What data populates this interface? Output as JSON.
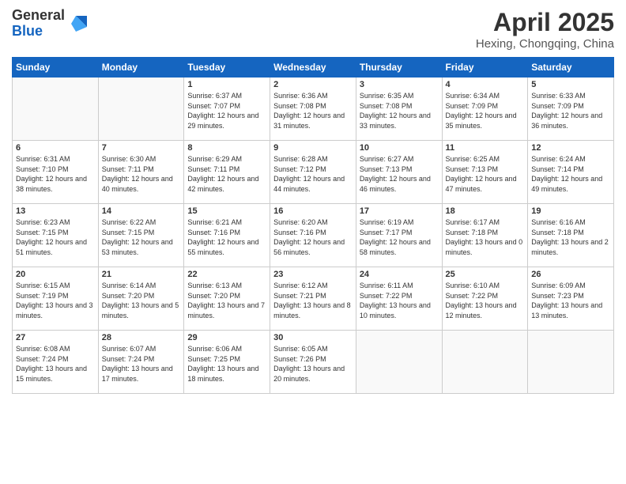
{
  "logo": {
    "general": "General",
    "blue": "Blue"
  },
  "title": "April 2025",
  "location": "Hexing, Chongqing, China",
  "days_header": [
    "Sunday",
    "Monday",
    "Tuesday",
    "Wednesday",
    "Thursday",
    "Friday",
    "Saturday"
  ],
  "weeks": [
    [
      {
        "num": "",
        "sunrise": "",
        "sunset": "",
        "daylight": ""
      },
      {
        "num": "",
        "sunrise": "",
        "sunset": "",
        "daylight": ""
      },
      {
        "num": "1",
        "sunrise": "Sunrise: 6:37 AM",
        "sunset": "Sunset: 7:07 PM",
        "daylight": "Daylight: 12 hours and 29 minutes."
      },
      {
        "num": "2",
        "sunrise": "Sunrise: 6:36 AM",
        "sunset": "Sunset: 7:08 PM",
        "daylight": "Daylight: 12 hours and 31 minutes."
      },
      {
        "num": "3",
        "sunrise": "Sunrise: 6:35 AM",
        "sunset": "Sunset: 7:08 PM",
        "daylight": "Daylight: 12 hours and 33 minutes."
      },
      {
        "num": "4",
        "sunrise": "Sunrise: 6:34 AM",
        "sunset": "Sunset: 7:09 PM",
        "daylight": "Daylight: 12 hours and 35 minutes."
      },
      {
        "num": "5",
        "sunrise": "Sunrise: 6:33 AM",
        "sunset": "Sunset: 7:09 PM",
        "daylight": "Daylight: 12 hours and 36 minutes."
      }
    ],
    [
      {
        "num": "6",
        "sunrise": "Sunrise: 6:31 AM",
        "sunset": "Sunset: 7:10 PM",
        "daylight": "Daylight: 12 hours and 38 minutes."
      },
      {
        "num": "7",
        "sunrise": "Sunrise: 6:30 AM",
        "sunset": "Sunset: 7:11 PM",
        "daylight": "Daylight: 12 hours and 40 minutes."
      },
      {
        "num": "8",
        "sunrise": "Sunrise: 6:29 AM",
        "sunset": "Sunset: 7:11 PM",
        "daylight": "Daylight: 12 hours and 42 minutes."
      },
      {
        "num": "9",
        "sunrise": "Sunrise: 6:28 AM",
        "sunset": "Sunset: 7:12 PM",
        "daylight": "Daylight: 12 hours and 44 minutes."
      },
      {
        "num": "10",
        "sunrise": "Sunrise: 6:27 AM",
        "sunset": "Sunset: 7:13 PM",
        "daylight": "Daylight: 12 hours and 46 minutes."
      },
      {
        "num": "11",
        "sunrise": "Sunrise: 6:25 AM",
        "sunset": "Sunset: 7:13 PM",
        "daylight": "Daylight: 12 hours and 47 minutes."
      },
      {
        "num": "12",
        "sunrise": "Sunrise: 6:24 AM",
        "sunset": "Sunset: 7:14 PM",
        "daylight": "Daylight: 12 hours and 49 minutes."
      }
    ],
    [
      {
        "num": "13",
        "sunrise": "Sunrise: 6:23 AM",
        "sunset": "Sunset: 7:15 PM",
        "daylight": "Daylight: 12 hours and 51 minutes."
      },
      {
        "num": "14",
        "sunrise": "Sunrise: 6:22 AM",
        "sunset": "Sunset: 7:15 PM",
        "daylight": "Daylight: 12 hours and 53 minutes."
      },
      {
        "num": "15",
        "sunrise": "Sunrise: 6:21 AM",
        "sunset": "Sunset: 7:16 PM",
        "daylight": "Daylight: 12 hours and 55 minutes."
      },
      {
        "num": "16",
        "sunrise": "Sunrise: 6:20 AM",
        "sunset": "Sunset: 7:16 PM",
        "daylight": "Daylight: 12 hours and 56 minutes."
      },
      {
        "num": "17",
        "sunrise": "Sunrise: 6:19 AM",
        "sunset": "Sunset: 7:17 PM",
        "daylight": "Daylight: 12 hours and 58 minutes."
      },
      {
        "num": "18",
        "sunrise": "Sunrise: 6:17 AM",
        "sunset": "Sunset: 7:18 PM",
        "daylight": "Daylight: 13 hours and 0 minutes."
      },
      {
        "num": "19",
        "sunrise": "Sunrise: 6:16 AM",
        "sunset": "Sunset: 7:18 PM",
        "daylight": "Daylight: 13 hours and 2 minutes."
      }
    ],
    [
      {
        "num": "20",
        "sunrise": "Sunrise: 6:15 AM",
        "sunset": "Sunset: 7:19 PM",
        "daylight": "Daylight: 13 hours and 3 minutes."
      },
      {
        "num": "21",
        "sunrise": "Sunrise: 6:14 AM",
        "sunset": "Sunset: 7:20 PM",
        "daylight": "Daylight: 13 hours and 5 minutes."
      },
      {
        "num": "22",
        "sunrise": "Sunrise: 6:13 AM",
        "sunset": "Sunset: 7:20 PM",
        "daylight": "Daylight: 13 hours and 7 minutes."
      },
      {
        "num": "23",
        "sunrise": "Sunrise: 6:12 AM",
        "sunset": "Sunset: 7:21 PM",
        "daylight": "Daylight: 13 hours and 8 minutes."
      },
      {
        "num": "24",
        "sunrise": "Sunrise: 6:11 AM",
        "sunset": "Sunset: 7:22 PM",
        "daylight": "Daylight: 13 hours and 10 minutes."
      },
      {
        "num": "25",
        "sunrise": "Sunrise: 6:10 AM",
        "sunset": "Sunset: 7:22 PM",
        "daylight": "Daylight: 13 hours and 12 minutes."
      },
      {
        "num": "26",
        "sunrise": "Sunrise: 6:09 AM",
        "sunset": "Sunset: 7:23 PM",
        "daylight": "Daylight: 13 hours and 13 minutes."
      }
    ],
    [
      {
        "num": "27",
        "sunrise": "Sunrise: 6:08 AM",
        "sunset": "Sunset: 7:24 PM",
        "daylight": "Daylight: 13 hours and 15 minutes."
      },
      {
        "num": "28",
        "sunrise": "Sunrise: 6:07 AM",
        "sunset": "Sunset: 7:24 PM",
        "daylight": "Daylight: 13 hours and 17 minutes."
      },
      {
        "num": "29",
        "sunrise": "Sunrise: 6:06 AM",
        "sunset": "Sunset: 7:25 PM",
        "daylight": "Daylight: 13 hours and 18 minutes."
      },
      {
        "num": "30",
        "sunrise": "Sunrise: 6:05 AM",
        "sunset": "Sunset: 7:26 PM",
        "daylight": "Daylight: 13 hours and 20 minutes."
      },
      {
        "num": "",
        "sunrise": "",
        "sunset": "",
        "daylight": ""
      },
      {
        "num": "",
        "sunrise": "",
        "sunset": "",
        "daylight": ""
      },
      {
        "num": "",
        "sunrise": "",
        "sunset": "",
        "daylight": ""
      }
    ]
  ]
}
